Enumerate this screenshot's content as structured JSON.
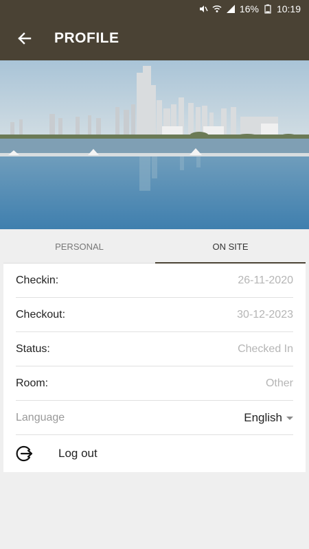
{
  "status_bar": {
    "battery": "16%",
    "time": "10:19",
    "icons": [
      "mute-icon",
      "wifi-icon",
      "signal-icon",
      "battery-icon"
    ]
  },
  "app_bar": {
    "title": "PROFILE",
    "back_icon": "arrow-left-icon"
  },
  "hero": {
    "icon": "city-skyline-photo"
  },
  "tabs": [
    {
      "label": "PERSONAL",
      "active": false
    },
    {
      "label": "ON SITE",
      "active": true
    }
  ],
  "fields": [
    {
      "label": "Checkin:",
      "value": "26-11-2020"
    },
    {
      "label": "Checkout:",
      "value": "30-12-2023"
    },
    {
      "label": "Status:",
      "value": "Checked In"
    },
    {
      "label": "Room:",
      "value": "Other"
    }
  ],
  "language": {
    "label": "Language",
    "selected": "English"
  },
  "logout": {
    "label": "Log out",
    "icon": "logout-icon"
  },
  "colors": {
    "app_bar": "#4a4234",
    "accent": "#4a4234",
    "background": "#efefef"
  }
}
